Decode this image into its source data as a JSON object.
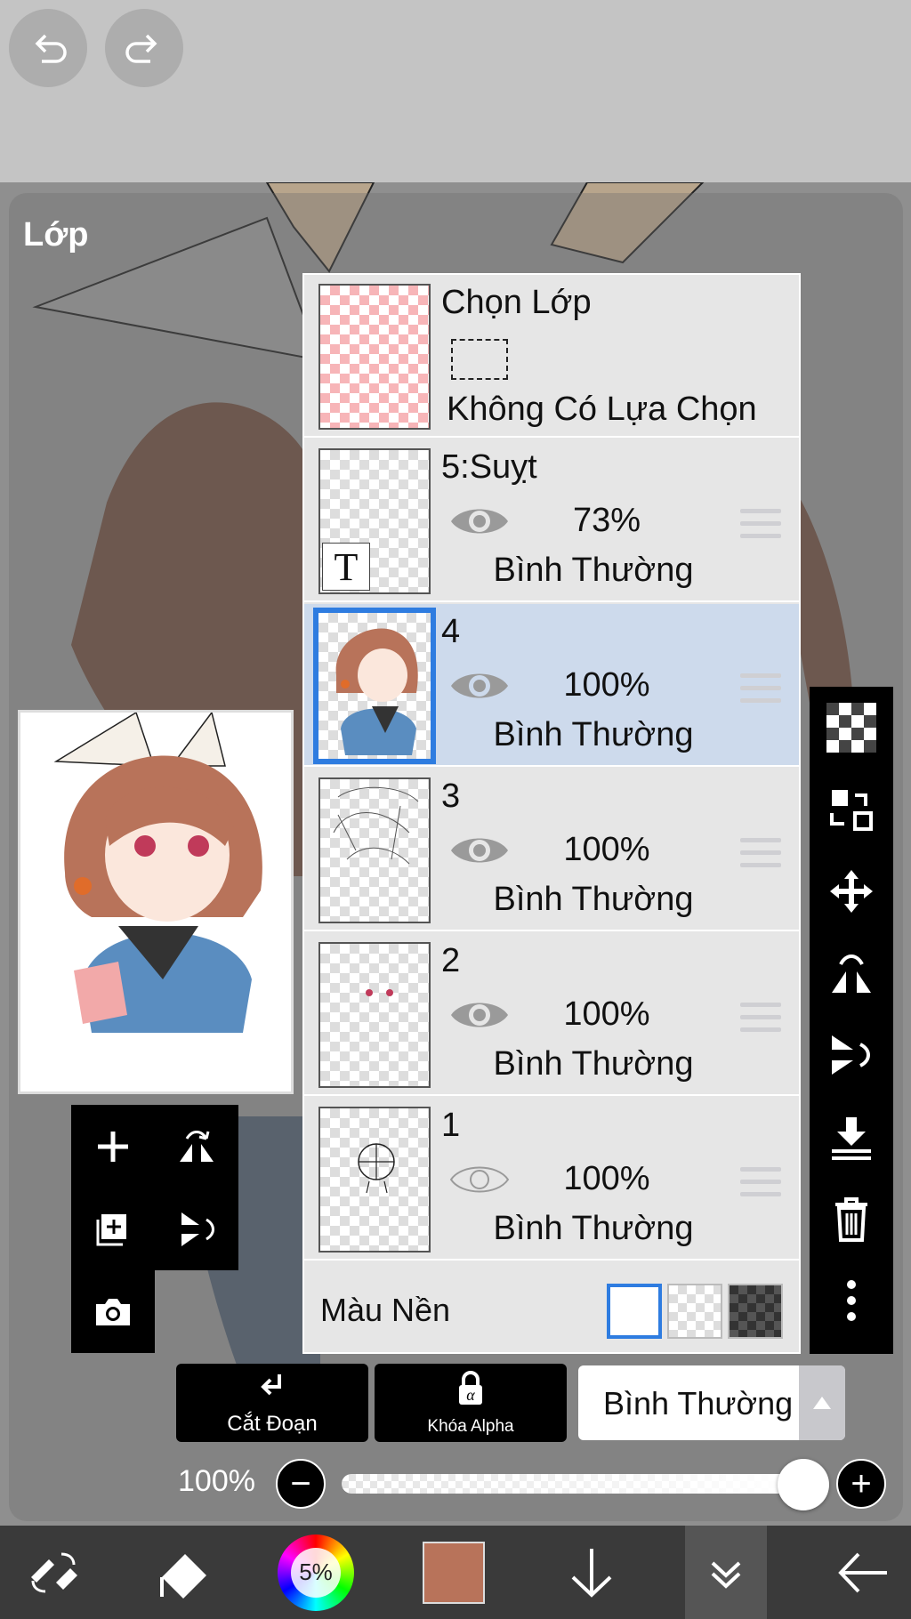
{
  "panel_title": "Lớp",
  "selection_layer": {
    "name": "Chọn Lớp",
    "status": "Không Có Lựa Chọn"
  },
  "layers": [
    {
      "name": "5:Suỵt",
      "opacity": "73%",
      "mode": "Bình Thường",
      "visible": true,
      "type": "text",
      "thumb_glyph": "T"
    },
    {
      "name": "4",
      "opacity": "100%",
      "mode": "Bình Thường",
      "visible": true,
      "selected": true
    },
    {
      "name": "3",
      "opacity": "100%",
      "mode": "Bình Thường",
      "visible": true
    },
    {
      "name": "2",
      "opacity": "100%",
      "mode": "Bình Thường",
      "visible": true
    },
    {
      "name": "1",
      "opacity": "100%",
      "mode": "Bình Thường",
      "visible": false
    }
  ],
  "background": {
    "label": "Màu Nền",
    "options": [
      "white",
      "transparent",
      "dark-checker"
    ],
    "selected": "white"
  },
  "actions": {
    "clip_label": "Cắt Đoạn",
    "alpha_lock_label": "Khóa Alpha"
  },
  "blend_mode": "Bình Thường",
  "opacity_slider": {
    "label": "100%",
    "value": 1.0,
    "minus": "−",
    "plus": "+"
  },
  "bottom_bar": {
    "color_wheel_label": "5%",
    "current_color": "#b8735a"
  },
  "colors": {
    "accent": "#2e7ce0",
    "selected_row": "#cddaec",
    "panel_bg": "#e6e6e6"
  }
}
